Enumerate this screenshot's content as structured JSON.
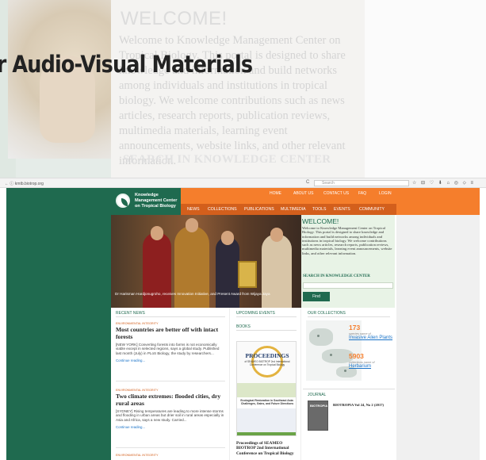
{
  "background": {
    "welcome_title": "WELCOME!",
    "welcome_text": "Welcome to Knowledge Management Center on Tropical Biology. This portal is designed to share knowledge and information and build networks among individuals and institutions in tropical biology. We welcome contributions such as news articles, research reports, publication reviews, multimedia materials, learning event announcements, website links, and other relevant information.",
    "search_heading": "SEARCH IN KNOWLEDGE CENTER",
    "overlay_title": "her Audio-Visual Materials"
  },
  "browser": {
    "url": "kmtb.biotrop.org",
    "search_placeholder": "Search",
    "reload_glyph": "C",
    "toolbar_glyphs": "☆ ⊟ ♡ ⬇ ⌂ ◎ ⬦ ≡"
  },
  "site": {
    "logo_text": "Knowledge Management Center on Tropical Biology",
    "top_nav": [
      "HOME",
      "ABOUT US",
      "CONTACT US",
      "FAQ",
      "LOGIN"
    ],
    "main_nav": [
      "NEWS",
      "COLLECTIONS",
      "PUBLICATIONS",
      "MULTIMEDIA",
      "TOOLS",
      "EVENTS",
      "COMMUNITY"
    ],
    "hero_caption": "Dr Harisman Hardjonugroho, receives Innovation Initiative, and Present Award from Wijaya Jaya",
    "welcome": {
      "title": "WELCOME!",
      "text": "Welcome to Knowledge Management Center on Tropical Biology. This portal is designed to share knowledge and information and build networks among individuals and institutions in tropical biology. We welcome contributions such as news articles, research reports, publication reviews, multimedia materials, learning event announcements, website links, and other relevant information.",
      "search_heading": "SEARCH IN KNOWLEDGE CENTER",
      "find_button": "Find"
    },
    "recent_news_heading": "RECENT NEWS",
    "news": [
      {
        "category": "ENVIRONMENTAL INTEGRITY",
        "title": "Most countries are better off with intact forests",
        "body": "[NEW YORK] Converting forests into farms is not economically viable except in selected regions, says a global study. Published last month (July) in PLoS Biology, the study by researchers...",
        "more": "Continue reading..."
      },
      {
        "category": "ENVIRONMENTAL INTEGRITY",
        "title": "Two climate extremes: flooded cities, dry rural areas",
        "body": "[SYDNEY] Rising temperatures are leading to more intense storms and flooding in urban areas but drier soil in rural areas especially in Asia and Africa, says a new study. Carried...",
        "more": "Continue reading..."
      },
      {
        "category": "ENVIRONMENTAL INTEGRITY"
      }
    ],
    "upcoming_events_heading": "UPCOMING EVENTS",
    "books_heading": "BOOKS",
    "book": {
      "cover_title": "PROCEEDINGS",
      "cover_sub": "of SEAMEO BIOTROP 2nd International Conference on Tropical Biology",
      "cover_band": "Ecological Restoration in Southeast Asia: Challenges, Gains, and Future Directions",
      "caption": "Proceedings of SEAMEO BIOTROP 2nd International Conference on Tropical Biology"
    },
    "collections_heading": "OUR COLLECTIONS",
    "collections": [
      {
        "count": "173",
        "label": "species name of",
        "link": "Invasive Alien Plants"
      },
      {
        "count": "5903",
        "label": "collections name of",
        "link": "Herbarium"
      }
    ],
    "journal_heading": "JOURNAL",
    "journal": {
      "cover_text": "BIOTROPIA",
      "title": "BIOTROPIA Vol 24, No 2 (2017)"
    }
  }
}
